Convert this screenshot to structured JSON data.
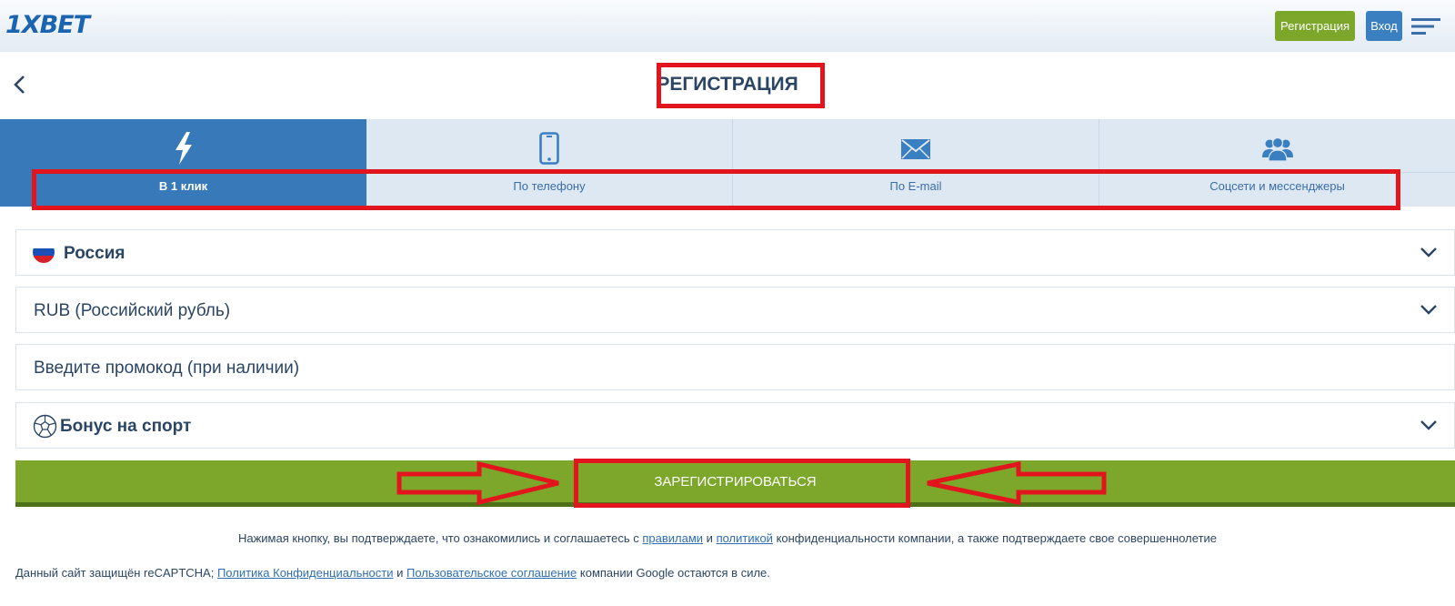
{
  "header": {
    "logo_text": "1XBET",
    "register_label": "Регистрация",
    "login_label": "Вход"
  },
  "page": {
    "title": "РЕГИСТРАЦИЯ"
  },
  "tabs": [
    {
      "label": "В 1 клик",
      "icon": "lightning-icon",
      "active": true
    },
    {
      "label": "По телефону",
      "icon": "phone-icon",
      "active": false
    },
    {
      "label": "По E-mail",
      "icon": "envelope-icon",
      "active": false
    },
    {
      "label": "Соцсети и мессенджеры",
      "icon": "users-icon",
      "active": false
    }
  ],
  "form": {
    "country": "Россия",
    "currency": "RUB (Российский рубль)",
    "promo_placeholder": "Введите промокод (при наличии)",
    "bonus": "Бонус на спорт",
    "submit_label": "ЗАРЕГИСТРИРОВАТЬСЯ"
  },
  "footer": {
    "terms_before": "Нажимая кнопку, вы подтверждаете, что ознакомились и соглашаетесь с",
    "terms_link_rules": "правилами",
    "terms_and": "и",
    "terms_link_policy": "политикой",
    "terms_after": "конфиденциальности компании, а также подтверждаете свое совершеннолетие",
    "captcha_before": "Данный сайт защищён reCAPTCHA;",
    "captcha_link_privacy": "Политика Конфиденциальности",
    "captcha_and": "и",
    "captcha_link_terms": "Пользовательское соглашение",
    "captcha_after": "компании Google остаются в силе."
  },
  "colors": {
    "brand_blue": "#1b64b0",
    "tab_active": "#3879ba",
    "accent_green": "#7ca72b",
    "annotation_red": "#e2141e"
  }
}
